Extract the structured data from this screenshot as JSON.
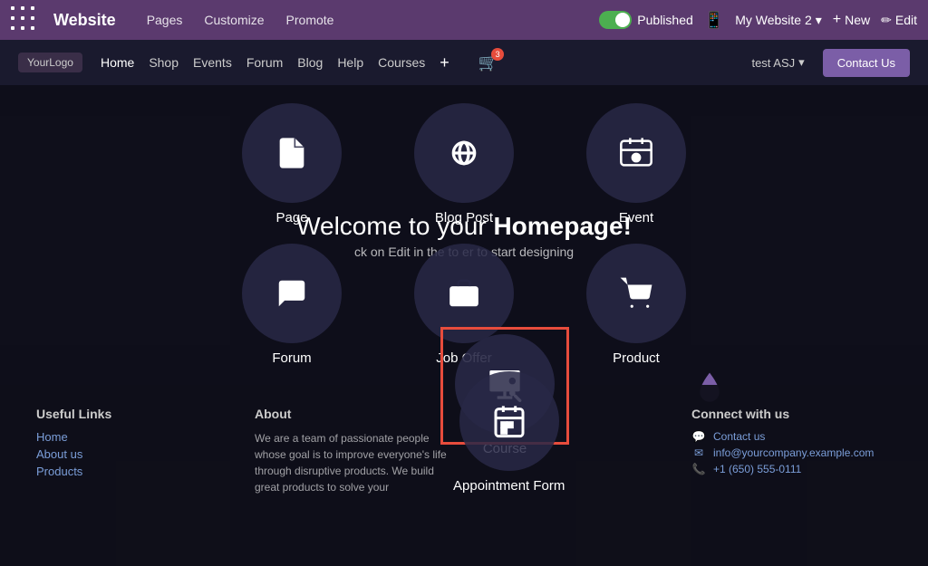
{
  "topnav": {
    "brand": "Website",
    "pages": "Pages",
    "customize": "Customize",
    "promote": "Promote",
    "published": "Published",
    "website_selector": "My Website 2",
    "new_btn": "New",
    "edit_btn": "Edit"
  },
  "sitenav": {
    "logo": "YourLogo",
    "links": [
      "Home",
      "Shop",
      "Events",
      "Forum",
      "Blog",
      "Help",
      "Courses"
    ],
    "cart_count": "3",
    "user": "test ASJ",
    "contact_btn": "Contact Us"
  },
  "circles": {
    "row1": [
      {
        "label": "Page",
        "icon": "📄"
      },
      {
        "label": "Blog Post",
        "icon": "📡"
      },
      {
        "label": "Event",
        "icon": "🎫"
      }
    ],
    "row2": [
      {
        "label": "Forum",
        "icon": "💬"
      },
      {
        "label": "Job Offer",
        "icon": "💼"
      },
      {
        "label": "Product",
        "icon": "🛒"
      }
    ],
    "row3": [
      {
        "label": "Course",
        "icon": "🖥",
        "selected": true
      },
      {
        "label": "Appointment Form",
        "icon": "📅"
      }
    ]
  },
  "welcome": {
    "line1": "Welcome to your ",
    "line1bold": "Homepage!",
    "line2": "ck on Edit in the to  er to start designing"
  },
  "footer": {
    "col1_title": "Useful Links",
    "col1_links": [
      "Home",
      "About us",
      "Products"
    ],
    "col2_title": "About",
    "col2_text": "We are a team of passionate people whose goal is to improve everyone's life through disruptive products. We build great products to solve your",
    "col3_title": "",
    "col4_title": "Connect with us",
    "col4_items": [
      "Contact us",
      "info@yourcompany.example.com",
      "+1 (650) 555-0111"
    ]
  }
}
